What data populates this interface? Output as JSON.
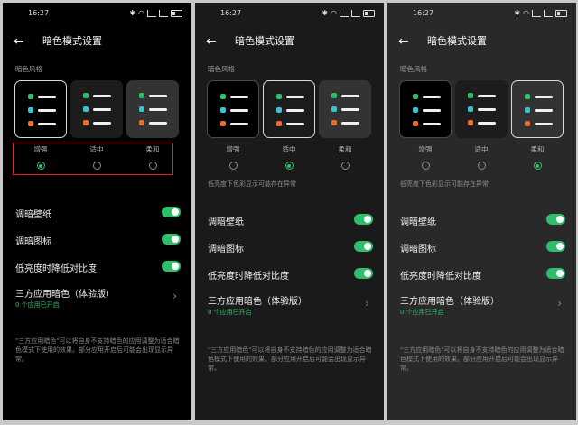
{
  "colors": {
    "accent": "#2fbf6a",
    "highlight_box": "#e0242a",
    "dot_green": "#2fbf6a",
    "dot_cyan": "#35c6cf",
    "dot_orange": "#f06a2a"
  },
  "panels": [
    {
      "status": {
        "time": "16:27"
      },
      "title": "暗色模式设置",
      "section_label": "暗色风格",
      "options": [
        {
          "label": "增强"
        },
        {
          "label": "适中"
        },
        {
          "label": "柔和"
        }
      ],
      "selected_option": 0,
      "highlighted": true,
      "note": "",
      "settings": [
        {
          "label": "调暗壁纸",
          "on": true
        },
        {
          "label": "调暗图标",
          "on": true
        },
        {
          "label": "低亮度时降低对比度",
          "on": true
        }
      ],
      "third_party": {
        "label": "三方应用暗色（体验版）",
        "sub": "0 个应用已开启"
      },
      "footnote": "\"三方应用暗色\"可以将自身不支持暗色的应用调整为适合暗色模式下使用的效果。部分应用开启后可能会出现显示异常。"
    },
    {
      "status": {
        "time": "16:27"
      },
      "title": "暗色模式设置",
      "section_label": "暗色风格",
      "options": [
        {
          "label": "增强"
        },
        {
          "label": "适中"
        },
        {
          "label": "柔和"
        }
      ],
      "selected_option": 1,
      "highlighted": false,
      "note": "低亮度下色彩显示可能存在异常",
      "settings": [
        {
          "label": "调暗壁纸",
          "on": true
        },
        {
          "label": "调暗图标",
          "on": true
        },
        {
          "label": "低亮度时降低对比度",
          "on": true
        }
      ],
      "third_party": {
        "label": "三方应用暗色（体验版）",
        "sub": "0 个应用已开启"
      },
      "footnote": "\"三方应用暗色\"可以将自身不支持暗色的应用调整为适合暗色模式下使用的效果。部分应用开启后可能会出现显示异常。"
    },
    {
      "status": {
        "time": "16:27"
      },
      "title": "暗色模式设置",
      "section_label": "暗色风格",
      "options": [
        {
          "label": "增强"
        },
        {
          "label": "适中"
        },
        {
          "label": "柔和"
        }
      ],
      "selected_option": 2,
      "highlighted": false,
      "note": "低亮度下色彩显示可能存在异常",
      "settings": [
        {
          "label": "调暗壁纸",
          "on": true
        },
        {
          "label": "调暗图标",
          "on": true
        },
        {
          "label": "低亮度时降低对比度",
          "on": true
        }
      ],
      "third_party": {
        "label": "三方应用暗色（体验版）",
        "sub": "0 个应用已开启"
      },
      "footnote": "\"三方应用暗色\"可以将自身不支持暗色的应用调整为适合暗色模式下使用的效果。部分应用开启后可能会出现显示异常。"
    }
  ]
}
